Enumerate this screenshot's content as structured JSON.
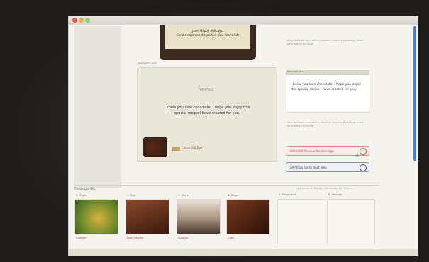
{
  "card_top": {
    "line1": "Jane, Happy Holidays.",
    "line2": "Send a note and the perfect New Year's Gift"
  },
  "preview": {
    "label": "Sample Card",
    "brand": "THE STORE",
    "message": "I know you love chocolate. I hope you enjoy this special recipe I have created for you.",
    "product_label": "Cocoa Gift Box"
  },
  "options": {
    "note_top": "Also available, pair with a seasonal recipe and package sized for a festive occasion",
    "message_label": "Message Line",
    "message_text": "I know you love chocolate. I hope you enjoy this special recipe I have created for you.",
    "note_bottom": "Also available, pair with a seasonal recipe and package sized for a festive occasion"
  },
  "buttons": {
    "preview": "PREVIEW  Preview the Message",
    "approve": "APPROVE  Go to Next Step"
  },
  "section": {
    "title": "Customize Gift",
    "right_text": "Last updated: Monday, December 10, 10 a.m."
  },
  "thumbnails": [
    {
      "num": "1. Origin",
      "caption": "Ecuador"
    },
    {
      "num": "2. Type",
      "caption": "Dark Infusion"
    },
    {
      "num": "3. Chefs",
      "caption": "Favorite"
    },
    {
      "num": "4. Shape",
      "caption": "Cube"
    }
  ],
  "panels": [
    {
      "title": "5. Personalize"
    },
    {
      "title": "6. Package"
    }
  ]
}
